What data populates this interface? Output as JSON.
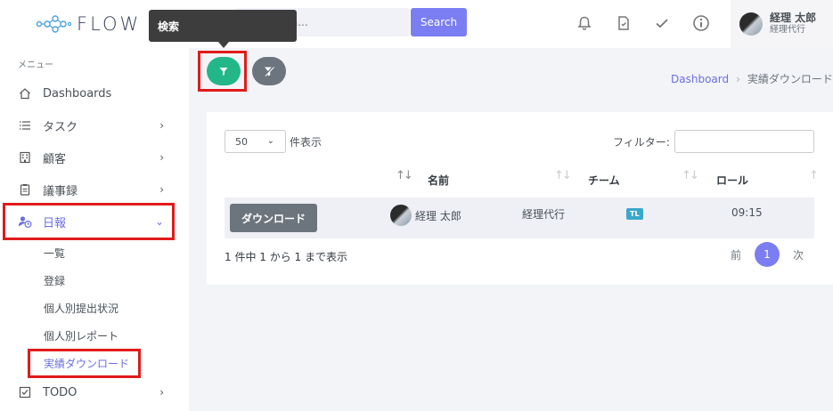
{
  "logo": {
    "text": "FLOW"
  },
  "header": {
    "search_placeholder": "Search...",
    "search_button": "Search",
    "user": {
      "name": "経理 太郎",
      "role": "経理代行"
    }
  },
  "tooltip": {
    "text": "検索"
  },
  "sidebar": {
    "section_title": "メニュー",
    "items": [
      {
        "label": "Dashboards",
        "icon": "home-icon"
      },
      {
        "label": "タスク",
        "icon": "list-icon"
      },
      {
        "label": "顧客",
        "icon": "building-icon"
      },
      {
        "label": "議事録",
        "icon": "clipboard-icon"
      },
      {
        "label": "日報",
        "icon": "user-clock-icon"
      },
      {
        "label": "TODO",
        "icon": "checkbox-icon"
      }
    ],
    "subitems": [
      "一覧",
      "登録",
      "個人別提出状況",
      "個人別レポート",
      "実績ダウンロード"
    ]
  },
  "breadcrumb": {
    "home": "Dashboard",
    "current": "実績ダウンロード"
  },
  "table": {
    "length_value": "50",
    "length_label": "件表示",
    "filter_label": "フィルター:",
    "columns": [
      "名前",
      "チーム",
      "ロール"
    ],
    "rows": [
      {
        "action": "ダウンロード",
        "name": "経理 太郎",
        "team": "経理代行",
        "role_badge": "TL",
        "time": "09:15"
      }
    ],
    "info": "1 件中 1 から 1 まで表示",
    "pagination": {
      "prev": "前",
      "current": "1",
      "next": "次"
    }
  },
  "colors": {
    "accent": "#7b7ef2",
    "filter_green": "#23b787",
    "highlight_red": "#e01b1b"
  }
}
